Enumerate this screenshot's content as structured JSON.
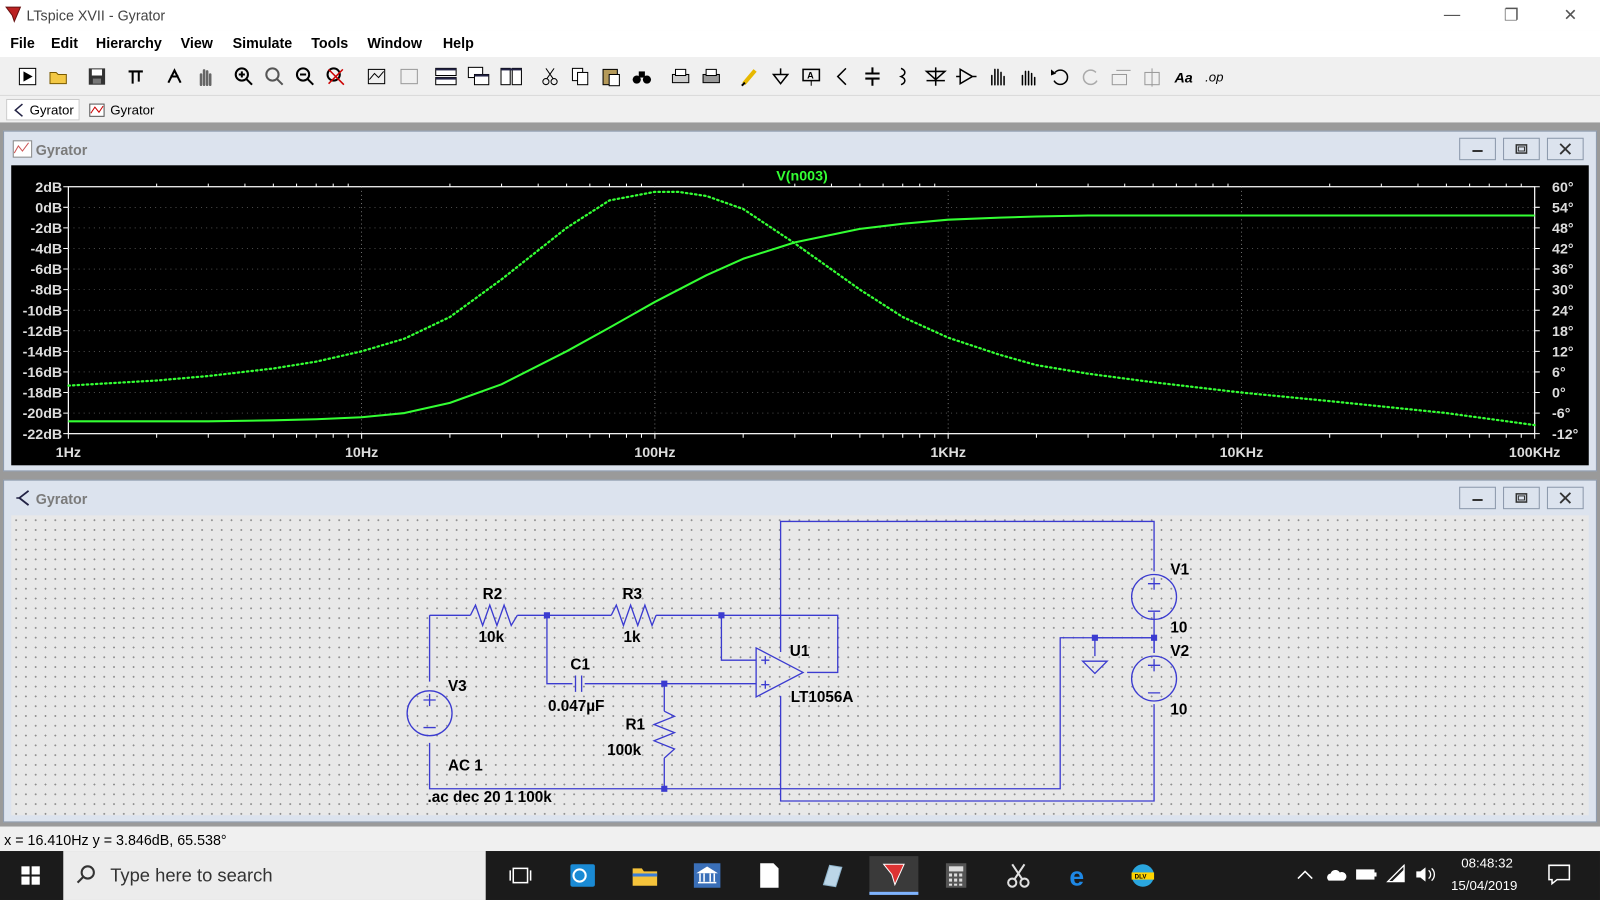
{
  "window": {
    "title": "LTspice XVII - Gyrator"
  },
  "menu": [
    "File",
    "Edit",
    "Hierarchy",
    "View",
    "Simulate",
    "Tools",
    "Window",
    "Help"
  ],
  "toolbar_icons": [
    "run-icon",
    "open-icon",
    "save-icon",
    "control-panel-icon",
    "halt-icon",
    "pan-icon",
    "zoom-in-icon",
    "zoom-fit-icon",
    "zoom-out-icon",
    "zoom-cancel-icon",
    "autorange-icon",
    "manual-limits-icon",
    "tile-horizontal-icon",
    "cascade-icon",
    "tile-vertical-icon",
    "cut-icon",
    "copy-icon",
    "paste-icon",
    "find-icon",
    "print-setup-icon",
    "print-icon",
    "wire-icon",
    "ground-icon",
    "label-icon",
    "resistor-icon",
    "capacitor-icon",
    "inductor-icon",
    "diode-icon",
    "component-icon",
    "move-icon",
    "drag-icon",
    "undo-icon",
    "redo-icon",
    "rotate-icon",
    "mirror-icon",
    "text-icon",
    "spice-directive-icon"
  ],
  "tabs": [
    {
      "label": "Gyrator",
      "kind": "schematic"
    },
    {
      "label": "Gyrator",
      "kind": "waveform"
    }
  ],
  "plot_window": {
    "title": "Gyrator"
  },
  "schematic_window": {
    "title": "Gyrator"
  },
  "chart_data": {
    "type": "line",
    "title": "V(n003)",
    "x_scale": "log",
    "x_ticks": [
      "1Hz",
      "10Hz",
      "100Hz",
      "1KHz",
      "10KHz",
      "100KHz"
    ],
    "xlim_hz": [
      1,
      100000
    ],
    "y_left_ticks": [
      "2dB",
      "0dB",
      "-2dB",
      "-4dB",
      "-6dB",
      "-8dB",
      "-10dB",
      "-12dB",
      "-14dB",
      "-16dB",
      "-18dB",
      "-20dB",
      "-22dB"
    ],
    "ylim_db": [
      -22,
      2
    ],
    "y_right_ticks": [
      "60°",
      "54°",
      "48°",
      "42°",
      "36°",
      "30°",
      "24°",
      "18°",
      "12°",
      "6°",
      "0°",
      "-6°",
      "-12°"
    ],
    "ylim_deg": [
      -12,
      60
    ],
    "grid": true,
    "color": "#33ff33",
    "series": [
      {
        "kind": "magnitude",
        "style": "solid",
        "unit": "dB",
        "x": [
          1,
          2,
          3,
          5,
          7,
          10,
          14,
          20,
          30,
          50,
          70,
          100,
          150,
          200,
          300,
          500,
          700,
          1000,
          1500,
          2000,
          3000,
          5000,
          10000,
          20000,
          50000,
          100000
        ],
        "y": [
          -20.8,
          -20.8,
          -20.8,
          -20.7,
          -20.6,
          -20.4,
          -20,
          -19,
          -17.2,
          -14,
          -11.7,
          -9.2,
          -6.6,
          -5,
          -3.4,
          -2.1,
          -1.6,
          -1.2,
          -1,
          -0.9,
          -0.8,
          -0.8,
          -0.8,
          -0.8,
          -0.8,
          -0.8
        ]
      },
      {
        "kind": "phase",
        "style": "dotted",
        "unit": "deg",
        "x": [
          1,
          2,
          3,
          5,
          7,
          10,
          14,
          20,
          30,
          50,
          70,
          100,
          120,
          150,
          200,
          300,
          500,
          700,
          1000,
          1500,
          2000,
          3000,
          5000,
          10000,
          20000,
          50000,
          100000
        ],
        "y": [
          2,
          3.5,
          4.8,
          7,
          9,
          12,
          15.7,
          22,
          33,
          48,
          56,
          58.5,
          58.5,
          57.3,
          53.5,
          43.5,
          30,
          22,
          16,
          11,
          8,
          5.5,
          3,
          0,
          -2.5,
          -6,
          -9.5
        ]
      }
    ]
  },
  "schematic": {
    "labels": {
      "r2_name": "R2",
      "r2_value": "10k",
      "r3_name": "R3",
      "r3_value": "1k",
      "c1_name": "C1",
      "c1_value": "0.047µF",
      "r1_name": "R1",
      "r1_value": "100k",
      "v3_name": "V3",
      "v3_value": "AC 1",
      "u1_name": "U1",
      "u1_value": "LT1056A",
      "v1_name": "V1",
      "v1_value": "10",
      "v2_name": "V2",
      "v2_value": "10",
      "directive": ".ac dec 20 1 100k"
    },
    "wire_color": "#3b3bd0"
  },
  "status": {
    "text": "x = 16.410Hz   y = 3.846dB, 65.538°"
  },
  "taskbar": {
    "search_placeholder": "Type here to search",
    "apps": [
      "task-view-icon",
      "outlook-icon",
      "file-explorer-icon",
      "bank-app-icon",
      "notepad-icon",
      "paint-icon",
      "ltspice-icon",
      "calculator-icon",
      "snipping-tool-icon",
      "edge-icon",
      "delivery-app-icon"
    ],
    "tray_icons": [
      "chevron-up-icon",
      "onedrive-icon",
      "battery-icon",
      "wifi-icon",
      "volume-icon"
    ],
    "time": "08:48:32",
    "date": "15/04/2019"
  }
}
